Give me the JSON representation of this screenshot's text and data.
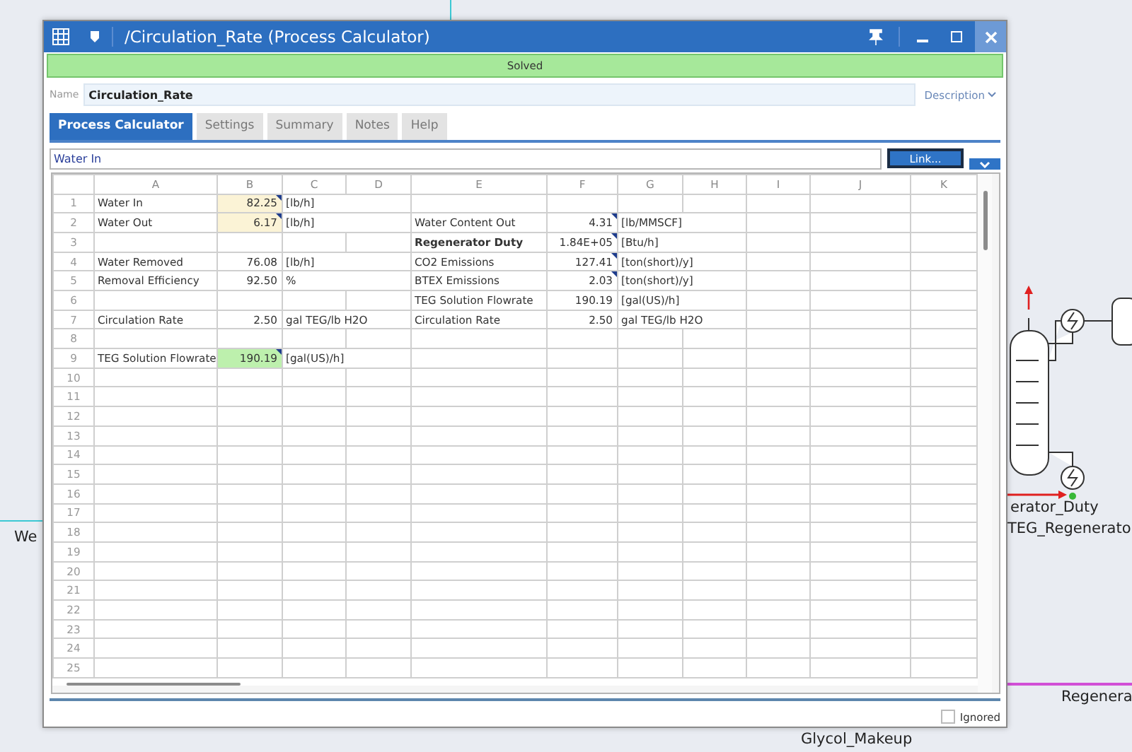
{
  "window": {
    "title": "/Circulation_Rate (Process Calculator)",
    "status": "Solved",
    "name_label": "Name",
    "name_value": "Circulation_Rate",
    "description": "Description"
  },
  "tabs": [
    {
      "label": "Process Calculator",
      "selected": true
    },
    {
      "label": "Settings",
      "selected": false
    },
    {
      "label": "Summary",
      "selected": false
    },
    {
      "label": "Notes",
      "selected": false
    },
    {
      "label": "Help",
      "selected": false
    }
  ],
  "formula_bar": {
    "value": "Water In",
    "link_button": "Link..."
  },
  "sheet": {
    "columns": [
      "A",
      "B",
      "C",
      "D",
      "E",
      "F",
      "G",
      "H",
      "I",
      "J",
      "K"
    ],
    "rows": [
      {
        "number": "1",
        "cells": [
          {
            "text": "Water In",
            "kind": "label",
            "bold": false,
            "flag": false
          },
          {
            "text": "82.25",
            "kind": "input",
            "bold": false,
            "flag": true
          },
          {
            "text": "[lb/h]",
            "kind": "unit",
            "bold": false,
            "flag": false
          }
        ]
      },
      {
        "number": "2",
        "cells": [
          {
            "text": "Water Out",
            "kind": "label",
            "bold": false,
            "flag": false
          },
          {
            "text": "6.17",
            "kind": "input",
            "bold": false,
            "flag": true
          },
          {
            "text": "[lb/h]",
            "kind": "unit",
            "bold": false,
            "flag": false
          },
          "",
          {
            "text": "Water Content Out",
            "kind": "label",
            "bold": false,
            "flag": false
          },
          {
            "text": "4.31",
            "kind": "value",
            "bold": false,
            "flag": true
          },
          {
            "text": "[lb/MMSCF]",
            "kind": "unit",
            "bold": false,
            "flag": false
          }
        ]
      },
      {
        "number": "3",
        "cells": [
          "",
          "",
          "",
          "",
          {
            "text": "Regenerator Duty",
            "kind": "label",
            "bold": true,
            "flag": false
          },
          {
            "text": "1.84E+05",
            "kind": "value",
            "bold": false,
            "flag": true
          },
          {
            "text": "[Btu/h]",
            "kind": "unit",
            "bold": false,
            "flag": false
          }
        ]
      },
      {
        "number": "4",
        "cells": [
          {
            "text": "Water Removed",
            "kind": "label",
            "bold": false,
            "flag": false
          },
          {
            "text": "76.08",
            "kind": "value",
            "bold": false,
            "flag": false
          },
          {
            "text": "[lb/h]",
            "kind": "unit",
            "bold": false,
            "flag": false
          },
          "",
          {
            "text": "CO2 Emissions",
            "kind": "label",
            "bold": false,
            "flag": false
          },
          {
            "text": "127.41",
            "kind": "value",
            "bold": false,
            "flag": true
          },
          {
            "text": "[ton(short)/y]",
            "kind": "unit",
            "bold": false,
            "flag": false
          }
        ]
      },
      {
        "number": "5",
        "cells": [
          {
            "text": "Removal Efficiency",
            "kind": "label",
            "bold": false,
            "flag": false
          },
          {
            "text": "92.50",
            "kind": "value",
            "bold": false,
            "flag": false
          },
          {
            "text": "%",
            "kind": "unit",
            "bold": false,
            "flag": false
          },
          "",
          {
            "text": "BTEX Emissions",
            "kind": "label",
            "bold": false,
            "flag": false
          },
          {
            "text": "2.03",
            "kind": "value",
            "bold": false,
            "flag": true
          },
          {
            "text": "[ton(short)/y]",
            "kind": "unit",
            "bold": false,
            "flag": false
          }
        ]
      },
      {
        "number": "6",
        "cells": [
          "",
          "",
          "",
          "",
          {
            "text": "TEG Solution Flowrate",
            "kind": "label",
            "bold": false,
            "flag": false
          },
          {
            "text": "190.19",
            "kind": "value",
            "bold": false,
            "flag": false
          },
          {
            "text": "[gal(US)/h]",
            "kind": "unit",
            "bold": false,
            "flag": false
          }
        ]
      },
      {
        "number": "7",
        "cells": [
          {
            "text": "Circulation Rate",
            "kind": "label",
            "bold": false,
            "flag": false
          },
          {
            "text": "2.50",
            "kind": "value",
            "bold": false,
            "flag": false
          },
          {
            "text": "gal TEG/lb H2O",
            "kind": "unit",
            "bold": false,
            "flag": false
          },
          "",
          {
            "text": "Circulation Rate",
            "kind": "label",
            "bold": false,
            "flag": false
          },
          {
            "text": "2.50",
            "kind": "value",
            "bold": false,
            "flag": false
          },
          {
            "text": "gal TEG/lb H2O",
            "kind": "unit",
            "bold": false,
            "flag": false
          }
        ]
      },
      {
        "number": "8"
      },
      {
        "number": "9",
        "cells": [
          {
            "text": "TEG Solution Flowrate",
            "kind": "label",
            "bold": false,
            "flag": false
          },
          {
            "text": "190.19",
            "kind": "result",
            "bold": false,
            "flag": true
          },
          {
            "text": "[gal(US)/h]",
            "kind": "unit",
            "bold": false,
            "flag": false
          }
        ]
      },
      {
        "number": "10"
      },
      {
        "number": "11"
      },
      {
        "number": "12"
      },
      {
        "number": "13"
      },
      {
        "number": "14"
      },
      {
        "number": "15"
      },
      {
        "number": "16"
      },
      {
        "number": "17"
      },
      {
        "number": "18"
      },
      {
        "number": "19"
      },
      {
        "number": "20"
      },
      {
        "number": "21"
      },
      {
        "number": "22"
      },
      {
        "number": "23"
      },
      {
        "number": "24"
      },
      {
        "number": "25"
      }
    ]
  },
  "ignored": {
    "label": "Ignored",
    "checked": false
  },
  "flowsheet": {
    "labels": [
      "We",
      "erator_Duty",
      "TEG_Regenerato",
      "Regenera",
      "Glycol_Makeup"
    ]
  }
}
